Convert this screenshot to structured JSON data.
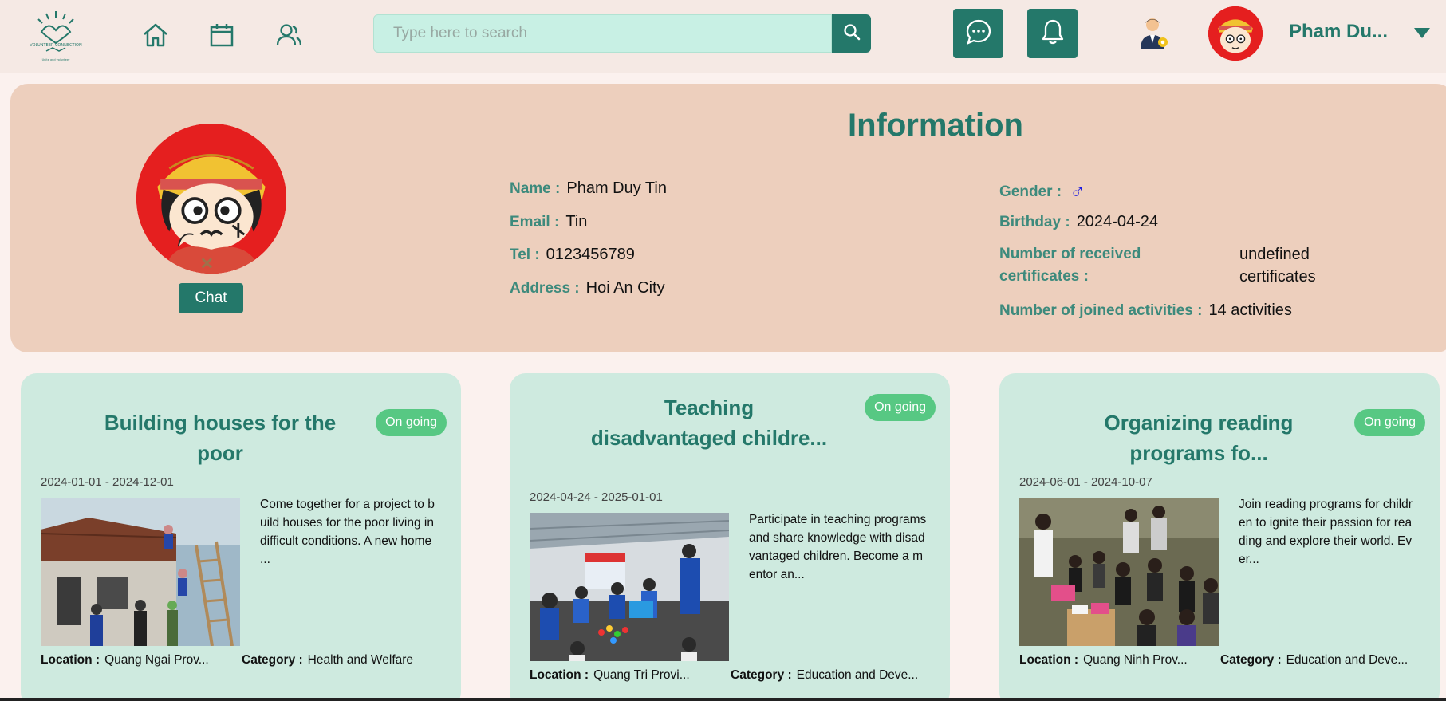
{
  "header": {
    "logo": {
      "icon": "volunteer-connection-logo",
      "text": "VOLUNTEER CONNECTION",
      "tagline": "Unite and volunteer"
    },
    "nav": [
      {
        "name": "home",
        "icon": "home-icon"
      },
      {
        "name": "calendar",
        "icon": "calendar-icon"
      },
      {
        "name": "users",
        "icon": "users-icon"
      }
    ],
    "search": {
      "placeholder": "Type here to search",
      "value": ""
    },
    "user": {
      "display_name": "Pham Du..."
    }
  },
  "profile": {
    "title": "Information",
    "chat_label": "Chat",
    "name_label": "Name :",
    "name": "Pham Duy Tin",
    "email_label": "Email :",
    "email": "Tin",
    "tel_label": "Tel :",
    "tel": "0123456789",
    "address_label": "Address :",
    "address": "Hoi An City",
    "gender_label": "Gender :",
    "gender_icon": "male-symbol-icon",
    "gender_symbol": "♂",
    "birthday_label": "Birthday :",
    "birthday": "2024-04-24",
    "certificates_label": "Number of received certificates :",
    "certificates": "undefined certificates",
    "activities_label": "Number of joined activities :",
    "activities": "14 activities"
  },
  "activities": [
    {
      "title": "Building houses for the poor",
      "status": "On going",
      "dates": "2024-01-01 - 2024-12-01",
      "description": "Come together for a project to build houses for the poor living in difficult conditions. A new home ...",
      "location_label": "Location :",
      "location": "Quang Ngai Prov...",
      "category_label": "Category :",
      "category": "Health and Welfare"
    },
    {
      "title": "Teaching disadvantaged childre...",
      "status": "On going",
      "dates": "2024-04-24 - 2025-01-01",
      "description": "Participate in teaching programs and share knowledge with disadvantaged children. Become a mentor an...",
      "location_label": "Location :",
      "location": "Quang Tri Provi...",
      "category_label": "Category :",
      "category": "Education and Deve..."
    },
    {
      "title": "Organizing reading programs fo...",
      "status": "On going",
      "dates": "2024-06-01 - 2024-10-07",
      "description": "Join reading programs for children to ignite their passion for reading and explore their world. Ever...",
      "location_label": "Location :",
      "location": "Quang Ninh Prov...",
      "category_label": "Category :",
      "category": "Education and Deve..."
    }
  ],
  "colors": {
    "primary": "#24786a",
    "badge": "#57c883",
    "panel": "#edcfbd",
    "card": "#ceeadf",
    "search": "#c8f0e4"
  }
}
